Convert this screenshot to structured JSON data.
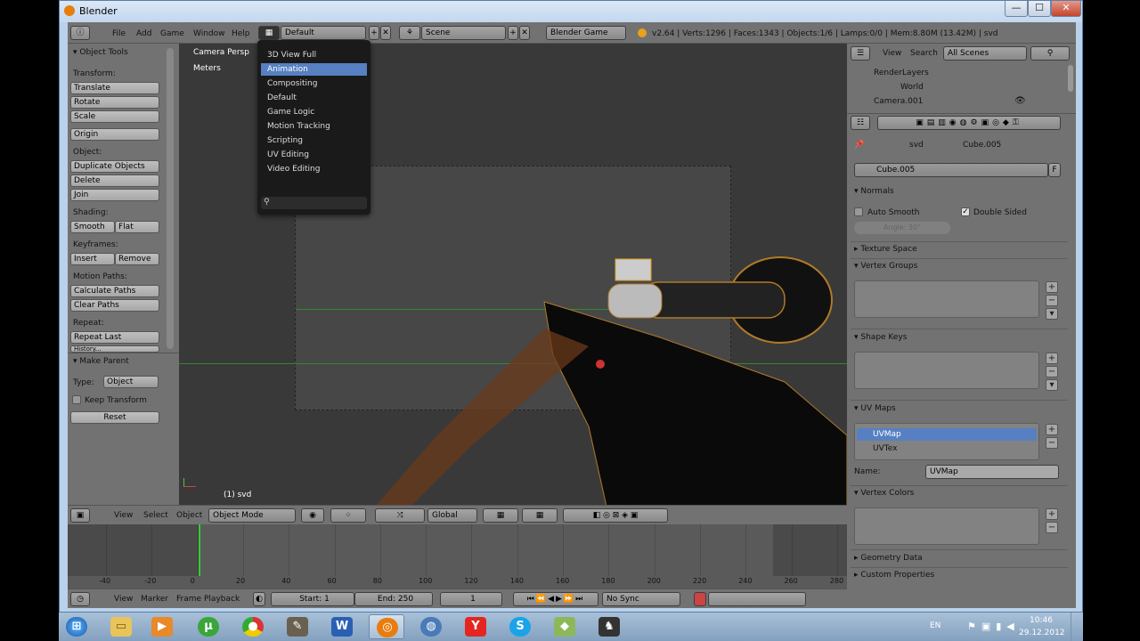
{
  "window": {
    "title": "Blender",
    "minimize": "—",
    "maximize": "☐",
    "close": "✕"
  },
  "info_header": {
    "menus": [
      "File",
      "Add",
      "Game",
      "Window",
      "Help"
    ],
    "layout": "Default",
    "scene": "Scene",
    "engine": "Blender Game",
    "stats": "v2.64 | Verts:1296 | Faces:1343 | Objects:1/6 | Lamps:0/0 | Mem:8.80M (13.42M) | svd"
  },
  "layout_menu": {
    "items": [
      "3D View Full",
      "Animation",
      "Compositing",
      "Default",
      "Game Logic",
      "Motion Tracking",
      "Scripting",
      "UV Editing",
      "Video Editing"
    ],
    "selected": "Animation"
  },
  "tool_shelf": {
    "title": "Object Tools",
    "transform_label": "Transform:",
    "translate": "Translate",
    "rotate": "Rotate",
    "scale": "Scale",
    "origin": "Origin",
    "object_label": "Object:",
    "duplicate": "Duplicate Objects",
    "delete": "Delete",
    "join": "Join",
    "shading_label": "Shading:",
    "smooth": "Smooth",
    "flat": "Flat",
    "keyframes_label": "Keyframes:",
    "insert": "Insert",
    "remove": "Remove",
    "motion_label": "Motion Paths:",
    "calc_paths": "Calculate Paths",
    "clear_paths": "Clear Paths",
    "repeat_label": "Repeat:",
    "repeat_last": "Repeat Last",
    "history": "History...",
    "make_parent": "Make Parent",
    "type_label": "Type:",
    "type_value": "Object",
    "keep_transform": "Keep Transform",
    "reset": "Reset"
  },
  "viewport": {
    "view_name": "Camera Persp",
    "units": "Meters",
    "object_label": "(1) svd"
  },
  "viewport_header": {
    "view": "View",
    "select": "Select",
    "object": "Object",
    "mode": "Object Mode",
    "orientation": "Global"
  },
  "timeline": {
    "ticks": [
      "-40",
      "-20",
      "0",
      "20",
      "40",
      "60",
      "80",
      "100",
      "120",
      "140",
      "160",
      "180",
      "200",
      "220",
      "240",
      "260",
      "280"
    ],
    "view": "View",
    "marker": "Marker",
    "frame": "Frame",
    "playback": "Playback",
    "start": "Start: 1",
    "end": "End: 250",
    "current": "1",
    "sync": "No Sync"
  },
  "outliner": {
    "view": "View",
    "search": "Search",
    "filter": "All Scenes",
    "items": [
      "RenderLayers",
      "World",
      "Camera.001"
    ]
  },
  "properties": {
    "breadcrumb_obj": "svd",
    "breadcrumb_mesh": "Cube.005",
    "mesh_name": "Cube.005",
    "fake_user": "F",
    "normals": "Normals",
    "auto_smooth": "Auto Smooth",
    "double_sided": "Double Sided",
    "angle": "Angle: 30°",
    "texture_space": "Texture Space",
    "vertex_groups": "Vertex Groups",
    "shape_keys": "Shape Keys",
    "uv_maps": "UV Maps",
    "uv_items": [
      "UVMap",
      "UVTex"
    ],
    "name_label": "Name:",
    "name_value": "UVMap",
    "vertex_colors": "Vertex Colors",
    "geometry_data": "Geometry Data",
    "custom_properties": "Custom Properties"
  },
  "taskbar": {
    "lang": "EN",
    "time": "10:46",
    "date": "29.12.2012"
  },
  "colors": {
    "select": "#5680c2",
    "panel": "#727272",
    "viewport": "#393939"
  }
}
